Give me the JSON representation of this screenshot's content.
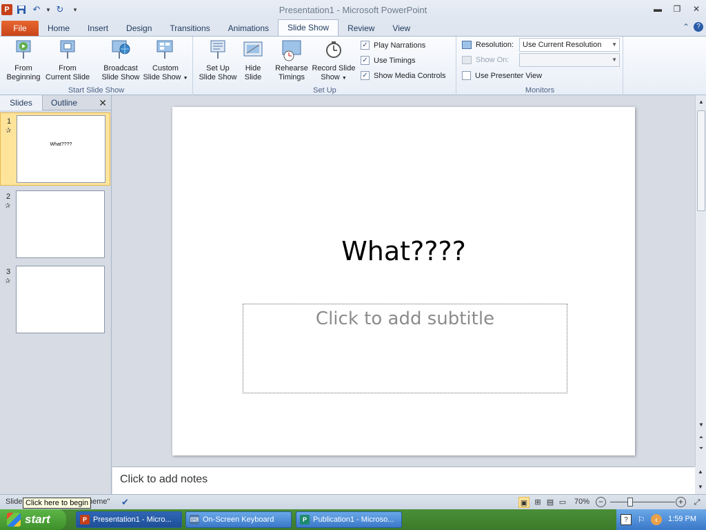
{
  "window": {
    "title": "Presentation1  -  Microsoft PowerPoint",
    "app_icon": "P"
  },
  "ribbon_tabs": [
    "File",
    "Home",
    "Insert",
    "Design",
    "Transitions",
    "Animations",
    "Slide Show",
    "Review",
    "View"
  ],
  "active_tab": "Slide Show",
  "start_group": {
    "label": "Start Slide Show",
    "from_beginning": [
      "From",
      "Beginning"
    ],
    "from_current": [
      "From",
      "Current Slide"
    ],
    "broadcast": [
      "Broadcast",
      "Slide Show"
    ],
    "custom": [
      "Custom",
      "Slide Show"
    ]
  },
  "setup_group": {
    "label": "Set Up",
    "setup": [
      "Set Up",
      "Slide Show"
    ],
    "hide": [
      "Hide",
      "Slide"
    ],
    "rehearse": [
      "Rehearse",
      "Timings"
    ],
    "record": [
      "Record Slide",
      "Show"
    ],
    "play_narrations": "Play Narrations",
    "use_timings": "Use Timings",
    "show_media": "Show Media Controls"
  },
  "monitors_group": {
    "label": "Monitors",
    "resolution_label": "Resolution:",
    "resolution_value": "Use Current Resolution",
    "show_on_label": "Show On:",
    "presenter_view": "Use Presenter View"
  },
  "panel": {
    "tab_slides": "Slides",
    "tab_outline": "Outline",
    "close": "✕",
    "thumbnails": [
      {
        "num": "1",
        "title": "What????"
      },
      {
        "num": "2",
        "title": ""
      },
      {
        "num": "3",
        "title": ""
      }
    ]
  },
  "slide": {
    "title": "What????",
    "subtitle_placeholder": "Click to add subtitle"
  },
  "notes_placeholder": "Click to add notes",
  "status": {
    "slide_label": "Slide",
    "theme_label": "heme\"",
    "tooltip": "Click here to begin",
    "zoom": "70%"
  },
  "taskbar": {
    "start": "start",
    "tasks": [
      {
        "label": "Presentation1 - Micro...",
        "icon": "P"
      },
      {
        "label": "On-Screen Keyboard",
        "icon": "⌨"
      },
      {
        "label": "Publication1 - Microso...",
        "icon": "P"
      }
    ],
    "clock": "1:59 PM"
  },
  "colors": {
    "file_tab": "#c9451a",
    "selected_thumb": "#fde49a",
    "taskbar": "#3b7a2a"
  }
}
